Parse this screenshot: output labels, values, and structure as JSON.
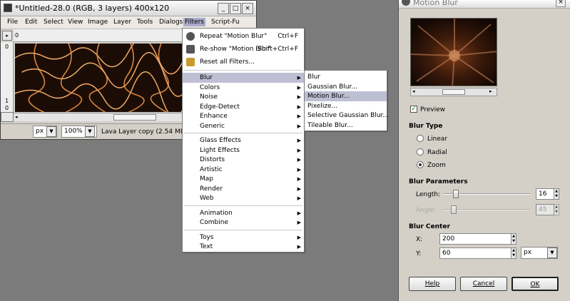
{
  "image_window": {
    "title": "*Untitled-28.0 (RGB, 3 layers) 400x120",
    "minimize": "_",
    "maximize": "□",
    "close": "×",
    "menubar": [
      "File",
      "Edit",
      "Select",
      "View",
      "Image",
      "Layer",
      "Tools",
      "Dialogs",
      "Filters",
      "Script-Fu"
    ],
    "ruler_h": [
      "0"
    ],
    "ruler_v": [
      "0",
      "1",
      "0"
    ],
    "status": {
      "unit": "px",
      "zoom": "100%",
      "info": "Lava Layer copy (2.54 MB)"
    }
  },
  "filters_menu": {
    "top_items": [
      {
        "label": "Repeat \"Motion Blur\"",
        "accel": "Ctrl+F",
        "icon": "repeat-filter-icon"
      },
      {
        "label": "Re-show \"Motion Blur\"",
        "accel": "Shift+Ctrl+F",
        "icon": "reshow-filter-icon"
      },
      {
        "label": "Reset all Filters...",
        "accel": "",
        "icon": "reset-filters-icon"
      }
    ],
    "groups": [
      [
        "Blur",
        "Colors",
        "Noise",
        "Edge-Detect",
        "Enhance",
        "Generic"
      ],
      [
        "Glass Effects",
        "Light Effects",
        "Distorts",
        "Artistic",
        "Map",
        "Render",
        "Web"
      ],
      [
        "Animation",
        "Combine"
      ],
      [
        "Toys",
        "Text"
      ]
    ],
    "highlighted": "Blur"
  },
  "blur_submenu": {
    "items": [
      "Blur",
      "Gaussian Blur...",
      "Motion Blur...",
      "Pixelize...",
      "Selective Gaussian Blur...",
      "Tileable Blur..."
    ],
    "highlighted": "Motion Blur..."
  },
  "motion_blur_dialog": {
    "title": "Motion Blur",
    "preview_label": "Preview",
    "preview_checked": true,
    "blur_type": {
      "header": "Blur Type",
      "options": [
        "Linear",
        "Radial",
        "Zoom"
      ],
      "selected": "Zoom"
    },
    "params": {
      "header": "Blur Parameters",
      "length_label": "Length:",
      "length_value": "16",
      "length_fraction": 0.15,
      "angle_label": "Angle:",
      "angle_value": "45",
      "angle_fraction": 0.12
    },
    "center": {
      "header": "Blur Center",
      "x_label": "X:",
      "x_value": "200",
      "y_label": "Y:",
      "y_value": "60",
      "unit": "px"
    },
    "buttons": {
      "help": "Help",
      "cancel": "Cancel",
      "ok": "OK"
    }
  },
  "colors": {
    "highlight": "#bfbfd4",
    "lava": "#e0904a",
    "dialog_bg": "#d4d0c8"
  }
}
